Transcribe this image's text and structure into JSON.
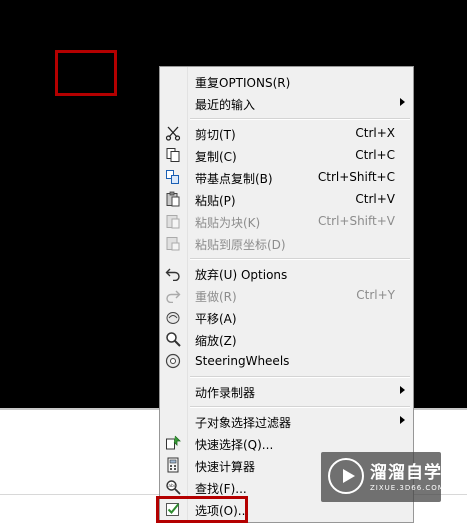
{
  "menu": {
    "repeat_options": {
      "label": "重复OPTIONS(R)"
    },
    "recent_input": {
      "label": "最近的输入"
    },
    "cut": {
      "label": "剪切(T)",
      "shortcut": "Ctrl+X"
    },
    "copy": {
      "label": "复制(C)",
      "shortcut": "Ctrl+C"
    },
    "copy_with_base": {
      "label": "带基点复制(B)",
      "shortcut": "Ctrl+Shift+C"
    },
    "paste": {
      "label": "粘贴(P)",
      "shortcut": "Ctrl+V"
    },
    "paste_as_block": {
      "label": "粘贴为块(K)",
      "shortcut": "Ctrl+Shift+V"
    },
    "paste_to_original": {
      "label": "粘贴到原坐标(D)"
    },
    "undo": {
      "label": "放弃(U) Options"
    },
    "redo": {
      "label": "重做(R)",
      "shortcut": "Ctrl+Y"
    },
    "pan": {
      "label": "平移(A)"
    },
    "zoom": {
      "label": "缩放(Z)"
    },
    "steering_wheels": {
      "label": "SteeringWheels"
    },
    "action_recorder": {
      "label": "动作录制器"
    },
    "subobject_filter": {
      "label": "子对象选择过滤器"
    },
    "quick_select": {
      "label": "快速选择(Q)..."
    },
    "quick_calc": {
      "label": "快速计算器"
    },
    "find": {
      "label": "查找(F)..."
    },
    "options": {
      "label": "选项(O)..."
    }
  },
  "watermark": {
    "title": "溜溜自学",
    "subtitle": "ZIXUE.3D66.COM"
  },
  "colors": {
    "annotation_red": "#b40000",
    "menu_bg": "#f0f0f0",
    "canvas_bg": "#000000"
  }
}
